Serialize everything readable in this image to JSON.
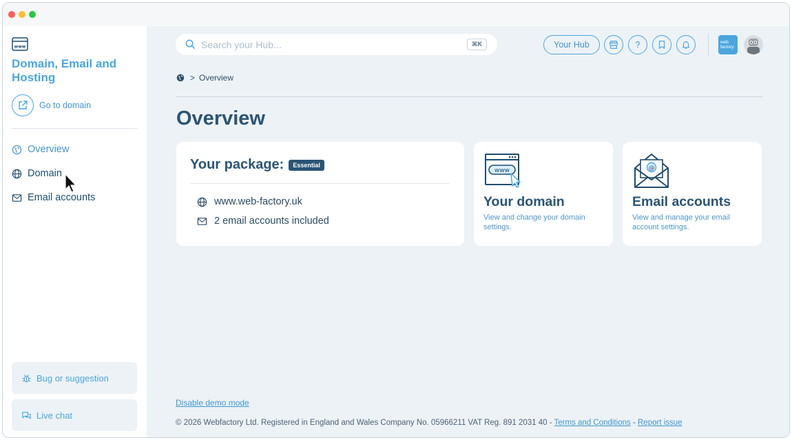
{
  "sidebar": {
    "title": "Domain, Email and Hosting",
    "goto_label": "Go to domain",
    "nav": [
      {
        "label": "Overview",
        "icon": "globe-outline-icon",
        "active": true
      },
      {
        "label": "Domain",
        "icon": "globe-icon",
        "active": false
      },
      {
        "label": "Email accounts",
        "icon": "mail-icon",
        "active": false
      }
    ],
    "bug_label": "Bug or suggestion",
    "chat_label": "Live chat"
  },
  "header": {
    "search_placeholder": "Search your Hub...",
    "shortcut": "⌘K",
    "hub_label": "Your Hub",
    "logo_text": "web factory",
    "icons": [
      "store-icon",
      "help-icon",
      "bookmark-icon",
      "bell-icon"
    ]
  },
  "breadcrumb": {
    "current": "Overview"
  },
  "page": {
    "title": "Overview"
  },
  "package": {
    "title": "Your package:",
    "badge": "Essential",
    "domain": "www.web-factory.uk",
    "emails": "2 email accounts included"
  },
  "tiles": {
    "domain": {
      "title": "Your domain",
      "desc": "View and change your domain settings.",
      "art_text": "www"
    },
    "email": {
      "title": "Email accounts",
      "desc": "View and manage your email account settings.",
      "art_text": "@"
    }
  },
  "footer": {
    "demo_link": "Disable demo mode",
    "copyright": "© 2026 Webfactory Ltd. Registered in England and Wales Company No. 05966211 VAT Reg. 891 2031 40 - ",
    "terms": "Terms and Conditions",
    "dash": " - ",
    "report": "Report issue"
  },
  "colors": {
    "accent": "#4aa6df",
    "navy": "#2a5475",
    "background": "#edf2f6"
  }
}
